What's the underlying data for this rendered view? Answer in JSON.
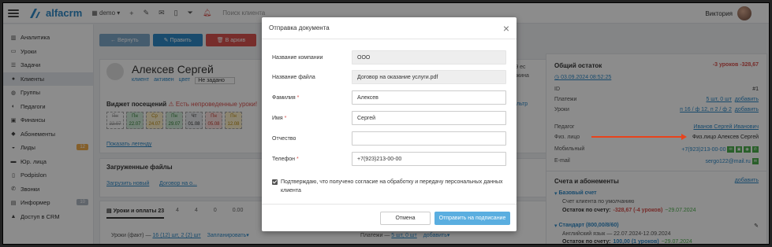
{
  "topbar": {
    "logo_text": "alfacrm",
    "branch": "demo",
    "search_placeholder": "Поиск клиента",
    "user_name": "Виктория"
  },
  "sidebar": {
    "items": [
      {
        "label": "Аналитика",
        "icon": "chart-icon"
      },
      {
        "label": "Уроки",
        "icon": "calendar-icon"
      },
      {
        "label": "Задачи",
        "icon": "tasks-icon"
      },
      {
        "label": "Клиенты",
        "icon": "user-icon"
      },
      {
        "label": "Группы",
        "icon": "group-icon"
      },
      {
        "label": "Педагоги",
        "icon": "teacher-icon"
      },
      {
        "label": "Финансы",
        "icon": "money-icon"
      },
      {
        "label": "Абонементы",
        "icon": "ticket-icon"
      },
      {
        "label": "Лиды",
        "icon": "leads-icon",
        "badge": "12"
      },
      {
        "label": "Юр. лица",
        "icon": "company-icon"
      },
      {
        "label": "Podpislon",
        "icon": "doc-icon"
      },
      {
        "label": "Звонки",
        "icon": "phone-icon"
      },
      {
        "label": "Информер",
        "icon": "informer-icon",
        "badge": "10"
      },
      {
        "label": "Доступ в CRM",
        "icon": "lock-icon"
      }
    ]
  },
  "toolbar": {
    "return_label": "Вернуть",
    "edit_label": "Править",
    "archive_label": "В архив"
  },
  "client": {
    "name": "Алексев Сергей",
    "tag_client": "клиент",
    "tag_active": "активен",
    "tag_color": "цвет",
    "status_value": "Не задано",
    "visits_title": "Виджет посещений",
    "visits_warning": "Есть непроведенные уроки!",
    "show_legend": "Показать легенду",
    "files_title": "Загруженные файлы",
    "upload_new": "Загрузить новый",
    "contract": "Договор на о...",
    "lessons_tab": "Уроки и оплаты 23",
    "lessons_fact": "Уроки (факт) —",
    "lessons_fact_value": "16 (12) шт, 2 (2) шт",
    "plan_link": "Запланировать",
    "payments_label": "Платежи —",
    "payments_value": "5 шт, 0 шт",
    "add_label": "добавить",
    "filter_link": "ильтр",
    "partial_count": "(9 ес",
    "partial_text": "ужина",
    "tabs_counts": [
      "4",
      "4",
      "0",
      "0.00"
    ]
  },
  "visits": [
    {
      "day": "Пн",
      "date": "22.07"
    },
    {
      "day": "Пн",
      "date": "22.07"
    },
    {
      "day": "Ср",
      "date": "24.07"
    },
    {
      "day": "Пн",
      "date": "29.07"
    },
    {
      "day": "Чт",
      "date": "01.08"
    },
    {
      "day": "Пн",
      "date": "05.08"
    },
    {
      "day": "Пн",
      "date": "12.08"
    }
  ],
  "right_panel": {
    "title": "Общий остаток",
    "balance": "-3 уроков -328,67",
    "date": "03.09.2024 08:52:25",
    "id_label": "ID",
    "id_value": "#1",
    "payments_label": "Платежи",
    "payments_value": "5 шт, 0 шт",
    "payments_action": "добавить",
    "lessons_label": "Уроки",
    "lessons_value": "п 16 / ф 12, п 2 / ф 2",
    "lessons_action": "добавить",
    "teacher_label": "Педагог",
    "teacher_value": "Иванов Сергей Иванович",
    "legal_label": "Физ. лицо",
    "legal_value": "Физ.лицо Алексев Сергей",
    "mobile_label": "Мобильный",
    "mobile_value": "+7(923)213-00-00",
    "email_label": "E-mail",
    "email_value": "sergo122@mail.ru",
    "subs_title": "Счета и абонементы",
    "subs_action": "добавить",
    "base_account": "Базовый счет",
    "base_desc": "Счет клиента по умолчанию",
    "base_balance_label": "Остаток по счету:",
    "base_balance_value": "-328,67 (-4 уроков)",
    "base_balance_date": "~29.07.2024",
    "std_title": "Стандарт (800,00/8/60)",
    "std_desc": "Английский язык — 22.07.2024-12.09.2024",
    "std_balance_label": "Остаток по счету:",
    "std_balance_value": "100,00 (1 уроков)",
    "std_balance_date": "~29.07.2024"
  },
  "modal": {
    "title": "Отправка документа",
    "fields": [
      {
        "label": "Название компании",
        "value": "ООО",
        "readonly": true,
        "required": false
      },
      {
        "label": "Название файла",
        "value": "Договор на оказание услуги.pdf",
        "readonly": true,
        "required": false
      },
      {
        "label": "Фамилия",
        "value": "Алексев",
        "readonly": false,
        "required": true
      },
      {
        "label": "Имя",
        "value": "Сергей",
        "readonly": false,
        "required": true
      },
      {
        "label": "Отчество",
        "value": "",
        "readonly": false,
        "required": false
      },
      {
        "label": "Телефон",
        "value": "+7(923)213-00-00",
        "readonly": false,
        "required": true
      }
    ],
    "consent_text": "Подтверждаю, что получено согласие на обработку и передачу персональных данных клиента",
    "cancel_label": "Отмена",
    "send_label": "Отправить на подписание"
  },
  "colors": {
    "accent": "#2e89c7",
    "danger": "#d9534f",
    "success": "#4cae4c",
    "arrow": "#e8431c"
  }
}
